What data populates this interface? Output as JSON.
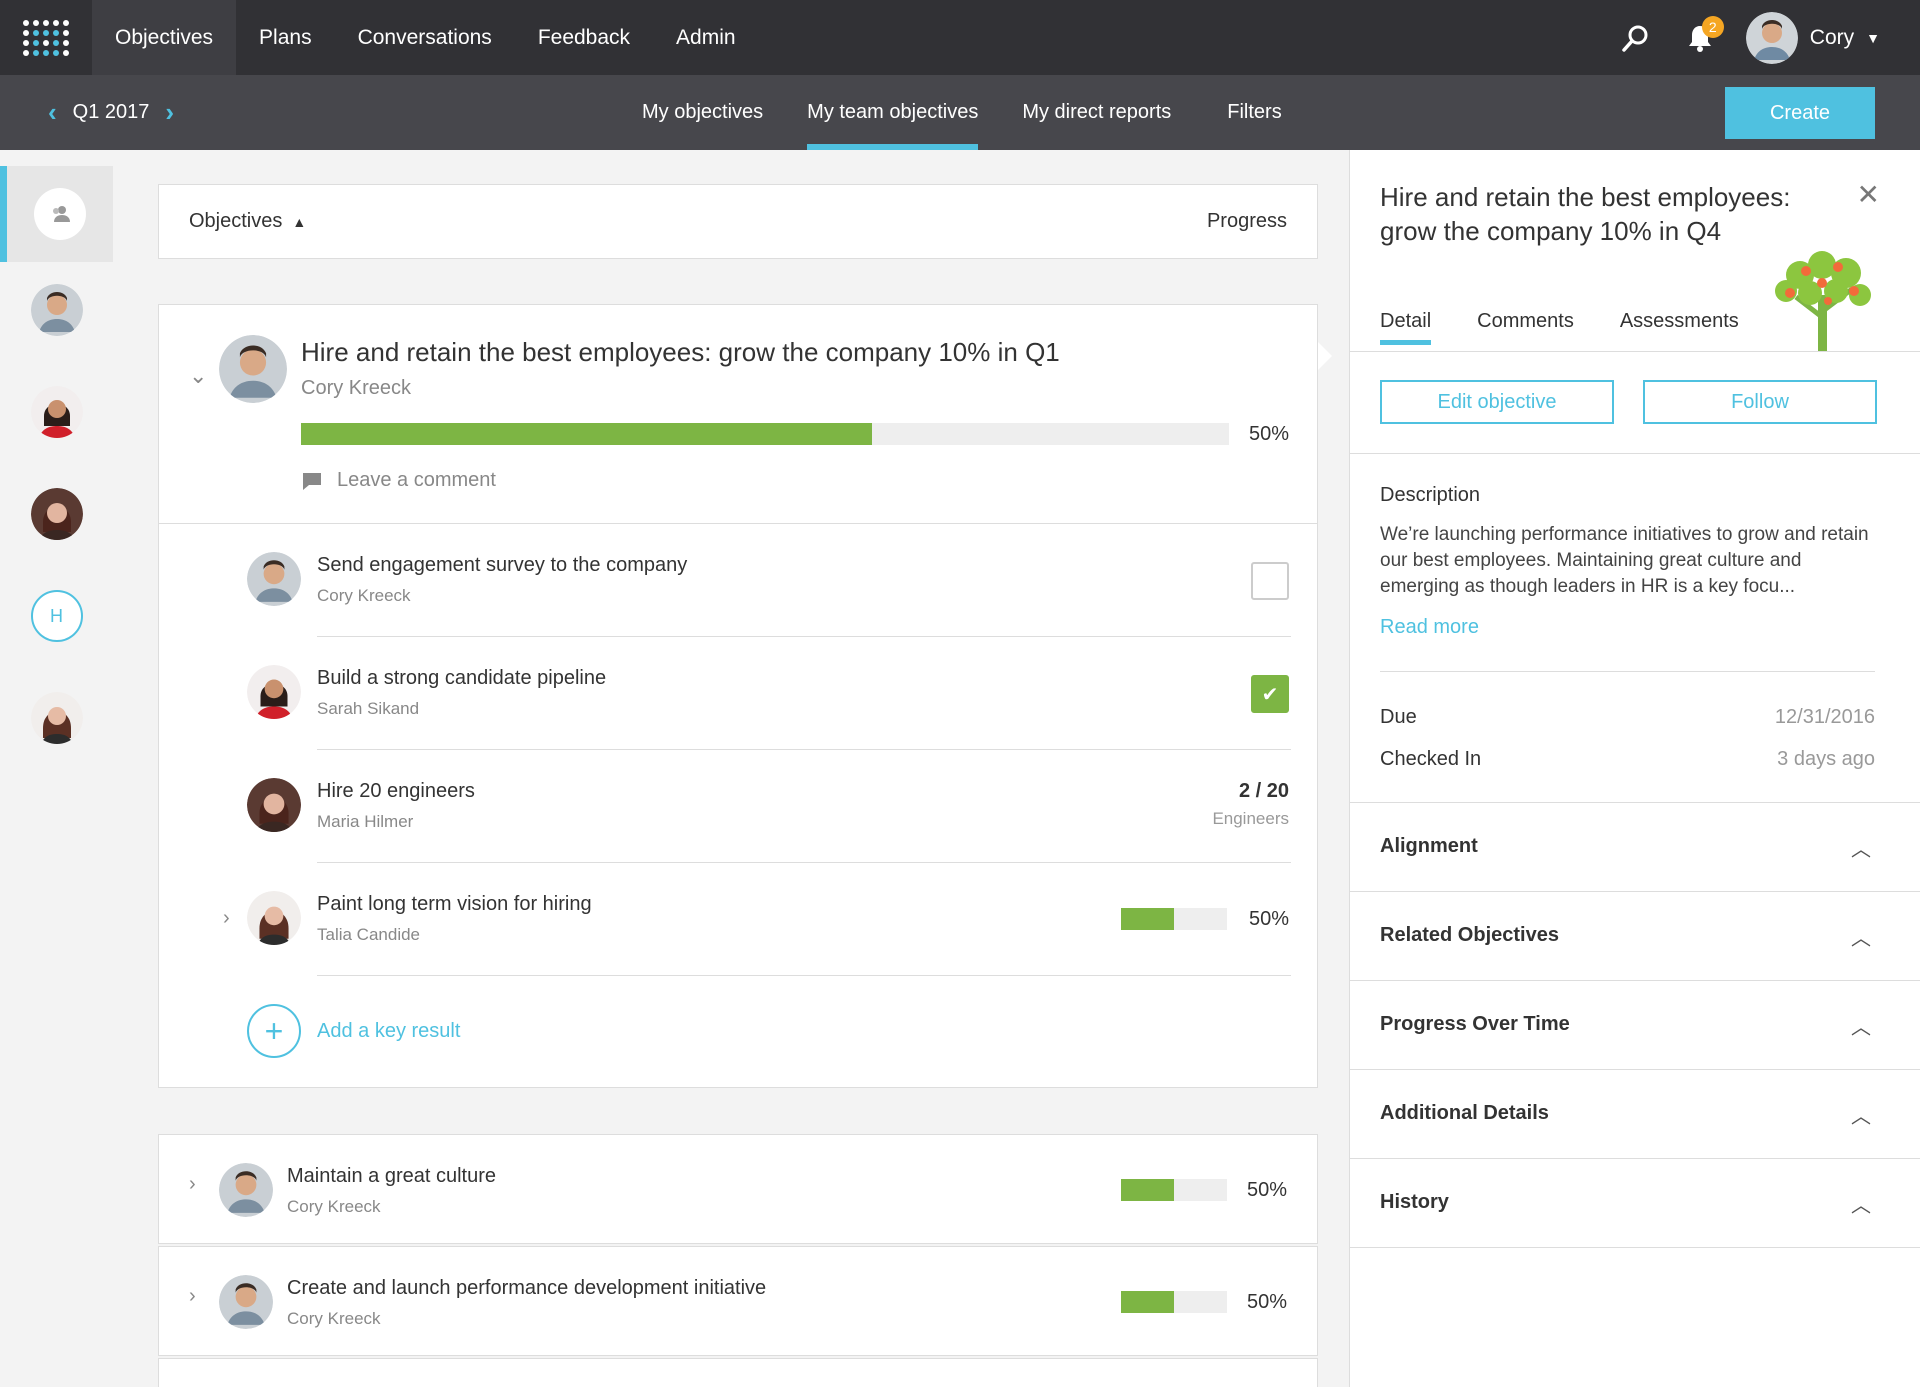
{
  "nav": {
    "items": [
      "Objectives",
      "Plans",
      "Conversations",
      "Feedback",
      "Admin"
    ],
    "notification_count": "2",
    "user_name": "Cory"
  },
  "subnav": {
    "period": "Q1 2017",
    "tabs": [
      "My objectives",
      "My team objectives",
      "My direct reports",
      "Filters"
    ],
    "create_label": "Create"
  },
  "rail": {
    "h_label": "H"
  },
  "list_header": {
    "objectives": "Objectives",
    "progress": "Progress"
  },
  "main_objective": {
    "title": "Hire and retain the best employees: grow the company 10% in Q1",
    "owner": "Cory Kreeck",
    "progress": 0.615,
    "progress_label": "50%",
    "comment_placeholder": "Leave a comment"
  },
  "key_results": [
    {
      "title": "Send engagement survey to the company",
      "owner": "Cory Kreeck",
      "done": false
    },
    {
      "title": "Build a strong candidate pipeline",
      "owner": "Sarah Sikand",
      "done": true
    },
    {
      "title": "Hire 20 engineers",
      "owner": "Maria Hilmer",
      "value": "2 / 20",
      "unit": "Engineers"
    },
    {
      "title": "Paint long term vision for hiring",
      "owner": "Talia Candide",
      "progress": 0.5,
      "progress_label": "50%"
    }
  ],
  "add_key_result": "Add a key result",
  "other_objectives": [
    {
      "title": "Maintain a great culture",
      "owner": "Cory Kreeck",
      "progress": 0.5,
      "progress_label": "50%"
    },
    {
      "title": "Create and launch performance development initiative",
      "owner": "Cory Kreeck",
      "progress": 0.5,
      "progress_label": "50%"
    }
  ],
  "panel": {
    "title": "Hire and retain the best employees: grow the company 10% in Q4",
    "tabs": [
      "Detail",
      "Comments",
      "Assessments"
    ],
    "edit_label": "Edit objective",
    "follow_label": "Follow",
    "description_label": "Description",
    "description": "We’re launching performance initiatives to grow and retain our best employees. Maintaining great culture and emerging as though leaders in HR is a key focu...",
    "read_more": "Read more",
    "due_label": "Due",
    "due_value": "12/31/2016",
    "checked_label": "Checked In",
    "checked_value": "3 days ago",
    "sections": [
      "Alignment",
      "Related Objectives",
      "Progress Over Time",
      "Additional Details",
      "History"
    ]
  },
  "colors": {
    "accent": "#4fc1e0",
    "progress": "#7db544",
    "topbar": "#313135",
    "subbar": "#47474c",
    "badge": "#f5a623"
  }
}
